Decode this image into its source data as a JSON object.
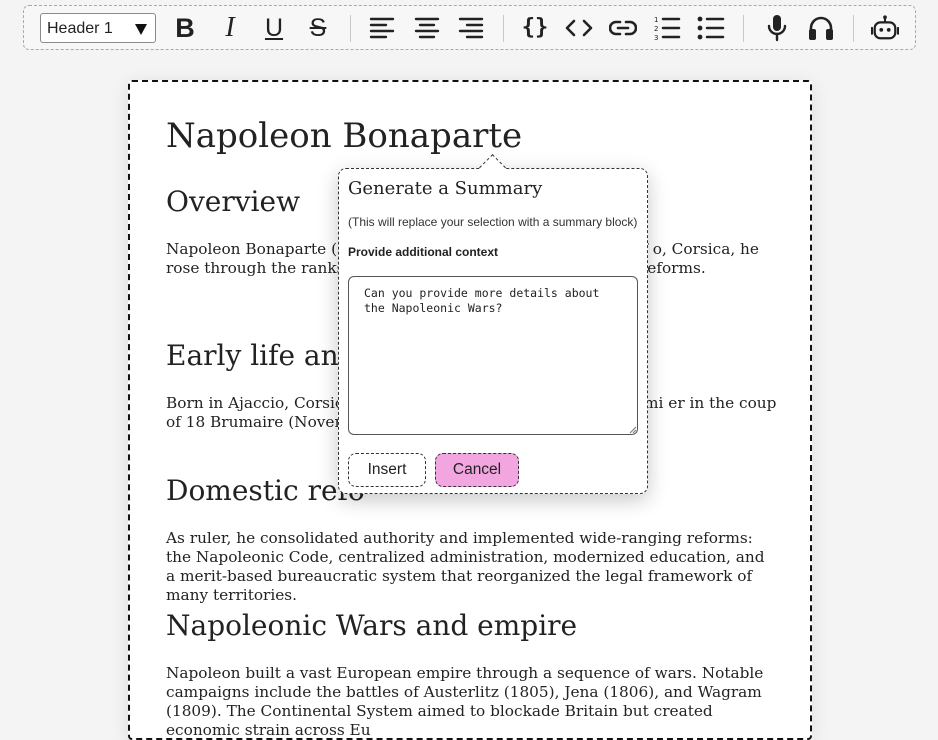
{
  "toolbar": {
    "heading_select": {
      "selected": "Header 1"
    },
    "buttons": [
      {
        "name": "bold",
        "glyph": "B"
      },
      {
        "name": "italic",
        "glyph": "I"
      },
      {
        "name": "underline",
        "glyph": "U"
      },
      {
        "name": "strikethrough",
        "glyph": "S"
      },
      {
        "name": "align-left"
      },
      {
        "name": "align-center"
      },
      {
        "name": "align-right"
      },
      {
        "name": "code-block",
        "glyph": "{}"
      },
      {
        "name": "inline-code",
        "glyph": "<>"
      },
      {
        "name": "link"
      },
      {
        "name": "ordered-list"
      },
      {
        "name": "bullet-list"
      },
      {
        "name": "microphone"
      },
      {
        "name": "headphones"
      },
      {
        "name": "ai-robot"
      }
    ]
  },
  "document": {
    "title": "Napoleon Bonaparte",
    "sections": [
      {
        "heading": "Overview",
        "text": "Napoleon Bonaparte (17                                                    mperor who dominated European aff                                           o, Corsica, he rose through the ranks during                                    ntralized state with sweeping reforms."
      },
      {
        "heading": "Early life and",
        "text": "Born in Ajaccio, Corsica,                                                 as an artillery officer. He gained promi                                        er in the coup of 18 Brumaire (November                                    nd later Emperor."
      },
      {
        "heading": "Domestic refo",
        "text": "As ruler, he consolidated authority and implemented wide-ranging reforms: the Napoleonic Code, centralized administration, modernized education, and a merit-based bureaucratic system that reorganized the legal framework of many territories."
      },
      {
        "heading": "Napoleonic Wars and empire",
        "text": "Napoleon built a vast European empire through a sequence of wars. Notable campaigns include the battles of Austerlitz (1805), Jena (1806), and Wagram (1809). The Continental System aimed to blockade Britain but created economic strain across Eu"
      }
    ]
  },
  "summary_popover": {
    "title": "Generate a Summary",
    "subtitle": "(This will replace your selection with a summary block)",
    "context_label": "Provide additional context",
    "context_value": "Can you provide more details about the Napoleonic Wars?",
    "insert_label": "Insert",
    "cancel_label": "Cancel"
  },
  "colors": {
    "cancel_button": "#f2a6e0",
    "page_background": "#f4f4f5"
  }
}
